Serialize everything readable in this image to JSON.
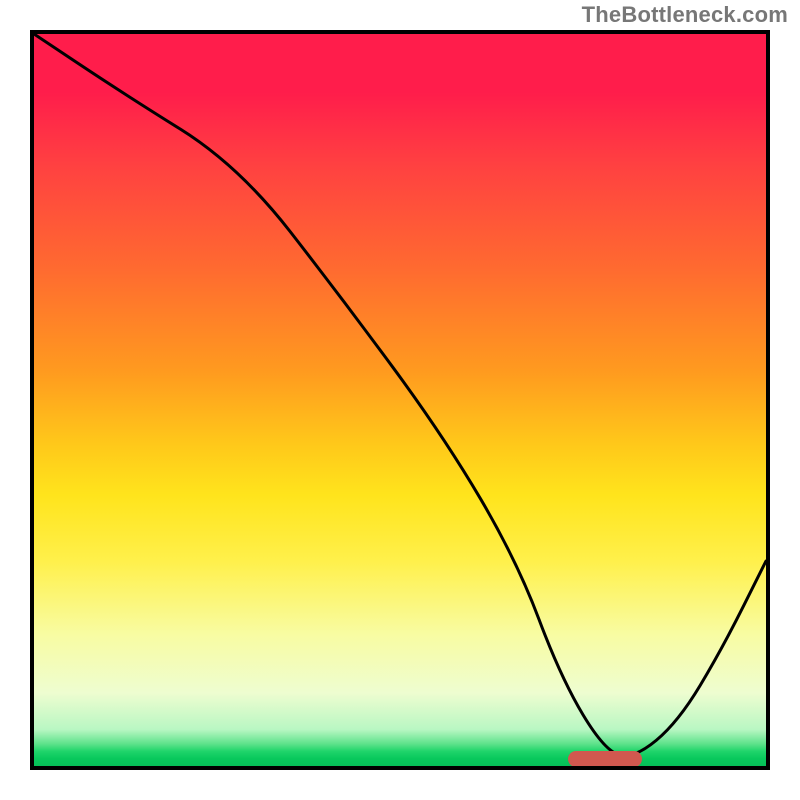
{
  "watermark": "TheBottleneck.com",
  "chart_data": {
    "type": "line",
    "title": "",
    "xlabel": "",
    "ylabel": "",
    "xlim": [
      0,
      100
    ],
    "ylim": [
      0,
      100
    ],
    "grid": false,
    "legend": false,
    "background": {
      "gradient_stops": [
        {
          "pos": 0,
          "color": "#ff1d4b"
        },
        {
          "pos": 32,
          "color": "#ff6a30"
        },
        {
          "pos": 56,
          "color": "#ffc81a"
        },
        {
          "pos": 72,
          "color": "#fff04b"
        },
        {
          "pos": 90,
          "color": "#eefdd0"
        },
        {
          "pos": 99,
          "color": "#08c85c"
        },
        {
          "pos": 100,
          "color": "#06c058"
        }
      ]
    },
    "series": [
      {
        "name": "bottleneck-curve",
        "x": [
          0,
          12,
          28,
          42,
          56,
          66,
          72,
          78,
          82,
          88,
          94,
          100
        ],
        "values": [
          100,
          92,
          82,
          64,
          45,
          28,
          12,
          2,
          1,
          6,
          16,
          28
        ]
      }
    ],
    "annotations": [
      {
        "name": "optimal-marker",
        "kind": "rounded-bar",
        "x_start": 73,
        "x_end": 83,
        "y": 1,
        "color": "#d1584f"
      }
    ]
  }
}
